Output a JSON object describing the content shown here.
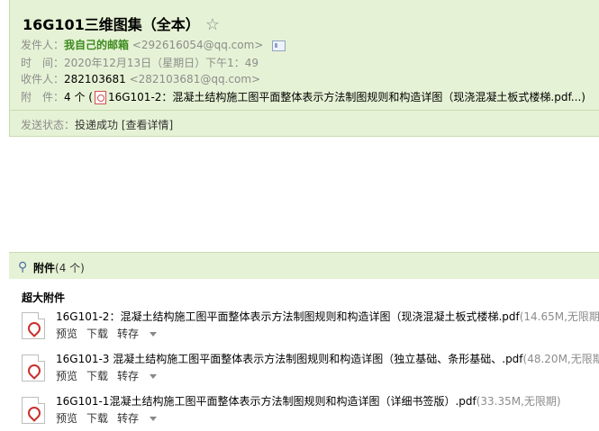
{
  "email": {
    "subject": "16G101三维图集（全本）",
    "star": "☆",
    "sender": {
      "label": "发件人：",
      "name": "我自己的邮箱",
      "address": "<292616054@qq.com>"
    },
    "time": {
      "label": "时　间：",
      "value": "2020年12月13日（星期日）下午1：49"
    },
    "recipient": {
      "label": "收件人：",
      "name": "282103681",
      "address": "<282103681@qq.com>"
    },
    "attachments_summary": {
      "label": "附　件：",
      "count": "4 个 (",
      "first_file": "16G101-2：混凝土结构施工图平面整体表示方法制图规则和构造详图（现浇混凝土板式楼梯.pdf...)"
    },
    "status": {
      "label": "发送状态：",
      "value": "投递成功",
      "details_link": "[查看详情]"
    }
  },
  "attachments": {
    "bar_title": "附件",
    "bar_count": "(4 个)",
    "section_heading": "超大附件",
    "files": [
      {
        "name": "16G101-2：混凝土结构施工图平面整体表示方法制图规则和构造详图（现浇混凝土板式楼梯.pdf",
        "meta": "(14.65M,无限期"
      },
      {
        "name": "16G101-3 混凝土结构施工图平面整体表示方法制图规则和构造详图（独立基础、条形基础、.pdf",
        "meta": "(48.20M,无限期"
      },
      {
        "name": "16G101-1混凝土结构施工图平面整体表示方法制图规则和构造详图（详细书签版）.pdf",
        "meta": "(33.35M,无限期)"
      }
    ],
    "actions": {
      "preview": "预览",
      "download": "下载",
      "save": "转存"
    }
  }
}
